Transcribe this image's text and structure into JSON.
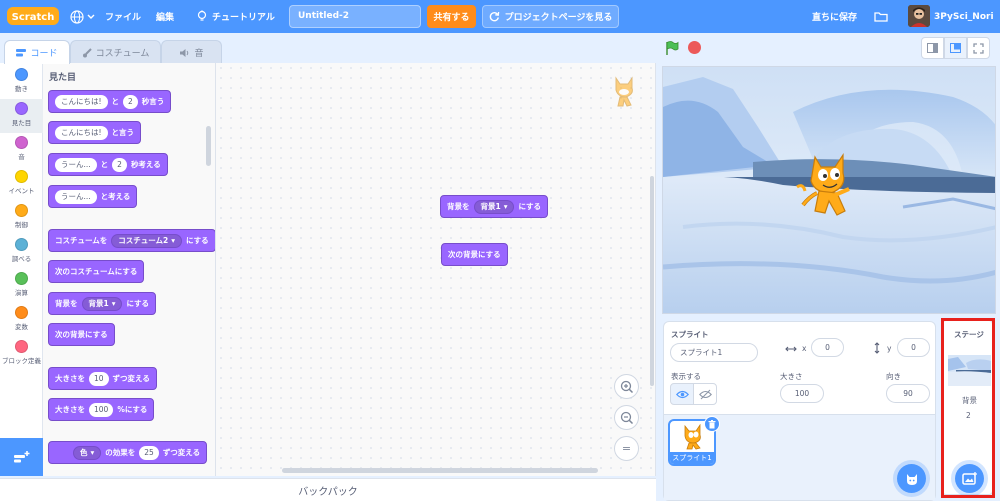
{
  "menubar": {
    "logo_text": "Scratch",
    "file": "ファイル",
    "edit": "編集",
    "tutorials": "チュートリアル",
    "project_title": "Untitled-2",
    "share": "共有する",
    "see_project_page": "プロジェクトページを見る",
    "save_now": "直ちに保存",
    "username": "3PySci_Nori"
  },
  "tabs": {
    "code": "コード",
    "costumes": "コスチューム",
    "sounds": "音"
  },
  "categories": [
    {
      "label": "動き",
      "color": "#4c97ff"
    },
    {
      "label": "見た目",
      "color": "#9966ff"
    },
    {
      "label": "音",
      "color": "#cf63cf"
    },
    {
      "label": "イベント",
      "color": "#ffd500"
    },
    {
      "label": "制御",
      "color": "#ffab19"
    },
    {
      "label": "調べる",
      "color": "#5cb1d6"
    },
    {
      "label": "演算",
      "color": "#59c059"
    },
    {
      "label": "変数",
      "color": "#ff8c1a"
    },
    {
      "label": "ブロック定義",
      "color": "#ff6680"
    }
  ],
  "flyout": {
    "title": "見た目",
    "blocks": {
      "say_for": {
        "text1": "こんにちは!",
        "mid": "と",
        "num": "2",
        "end": "秒言う"
      },
      "say": {
        "text1": "こんにちは!",
        "end": "と言う"
      },
      "think_for": {
        "text1": "うーん...",
        "mid": "と",
        "num": "2",
        "end": "秒考える"
      },
      "think": {
        "text1": "うーん...",
        "end": "と考える"
      },
      "switch_costume": {
        "start": "コスチュームを",
        "dd": "コスチューム2",
        "end": "にする"
      },
      "next_costume": "次のコスチュームにする",
      "switch_backdrop": {
        "start": "背景を",
        "dd": "背景1",
        "end": "にする"
      },
      "next_backdrop": "次の背景にする",
      "change_size": {
        "start": "大きさを",
        "num": "10",
        "end": "ずつ変える"
      },
      "set_size": {
        "start": "大きさを",
        "num": "100",
        "end": "%にする"
      },
      "change_effect": {
        "dd": "色",
        "mid": "の効果を",
        "num": "25",
        "end": "ずつ変える"
      }
    }
  },
  "scripts": {
    "switch_backdrop": {
      "start": "背景を",
      "dd": "背景1",
      "end": "にする"
    },
    "next_backdrop": "次の背景にする"
  },
  "zoom": {
    "in": "+",
    "out": "−",
    "reset": "="
  },
  "backpack": "バックパック",
  "sprite_info": {
    "sprite_label": "スプライト",
    "sprite_name": "スプライト1",
    "x_label": "x",
    "x_value": "0",
    "y_label": "y",
    "y_value": "0",
    "show_label": "表示する",
    "size_label": "大きさ",
    "size_value": "100",
    "direction_label": "向き",
    "direction_value": "90"
  },
  "sprite_list": [
    {
      "name": "スプライト1"
    }
  ],
  "stage_selector": {
    "title": "ステージ",
    "backdrops_label": "背景",
    "backdrops_count": "2"
  },
  "colors": {
    "menubar": "#4c97ff",
    "looks_block": "#9966ff",
    "share": "#ff8c1a",
    "highlight": "#e8211c"
  }
}
